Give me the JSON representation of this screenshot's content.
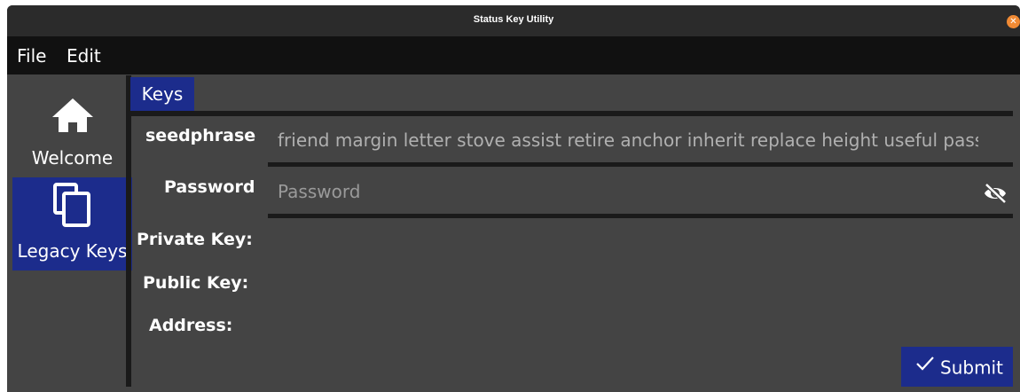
{
  "window": {
    "title": "Status Key Utility",
    "close_icon": "close-icon"
  },
  "menu": {
    "file": "File",
    "edit": "Edit"
  },
  "sidebar": {
    "items": [
      {
        "label": "Welcome",
        "icon": "home-icon",
        "selected": false
      },
      {
        "label": "Legacy Keys",
        "icon": "copy-icon",
        "selected": true
      }
    ]
  },
  "tabs": [
    {
      "label": "Keys",
      "selected": true
    }
  ],
  "form": {
    "seedphrase": {
      "label": "seedphrase",
      "value": "friend margin letter stove assist retire anchor inherit replace height useful pass"
    },
    "password": {
      "label": "Password",
      "placeholder": "Password",
      "value": "",
      "toggle_icon": "eye-off-icon"
    },
    "outputs": {
      "private_key_label": "Private Key:",
      "public_key_label": "Public Key:",
      "address_label": "Address:"
    }
  },
  "submit": {
    "label": "Submit",
    "icon": "check-icon"
  },
  "colors": {
    "accent": "#1c2c8c",
    "background": "#444444",
    "titlebar": "#2b2b2b",
    "menubar": "#111111",
    "close": "#f08a34"
  }
}
